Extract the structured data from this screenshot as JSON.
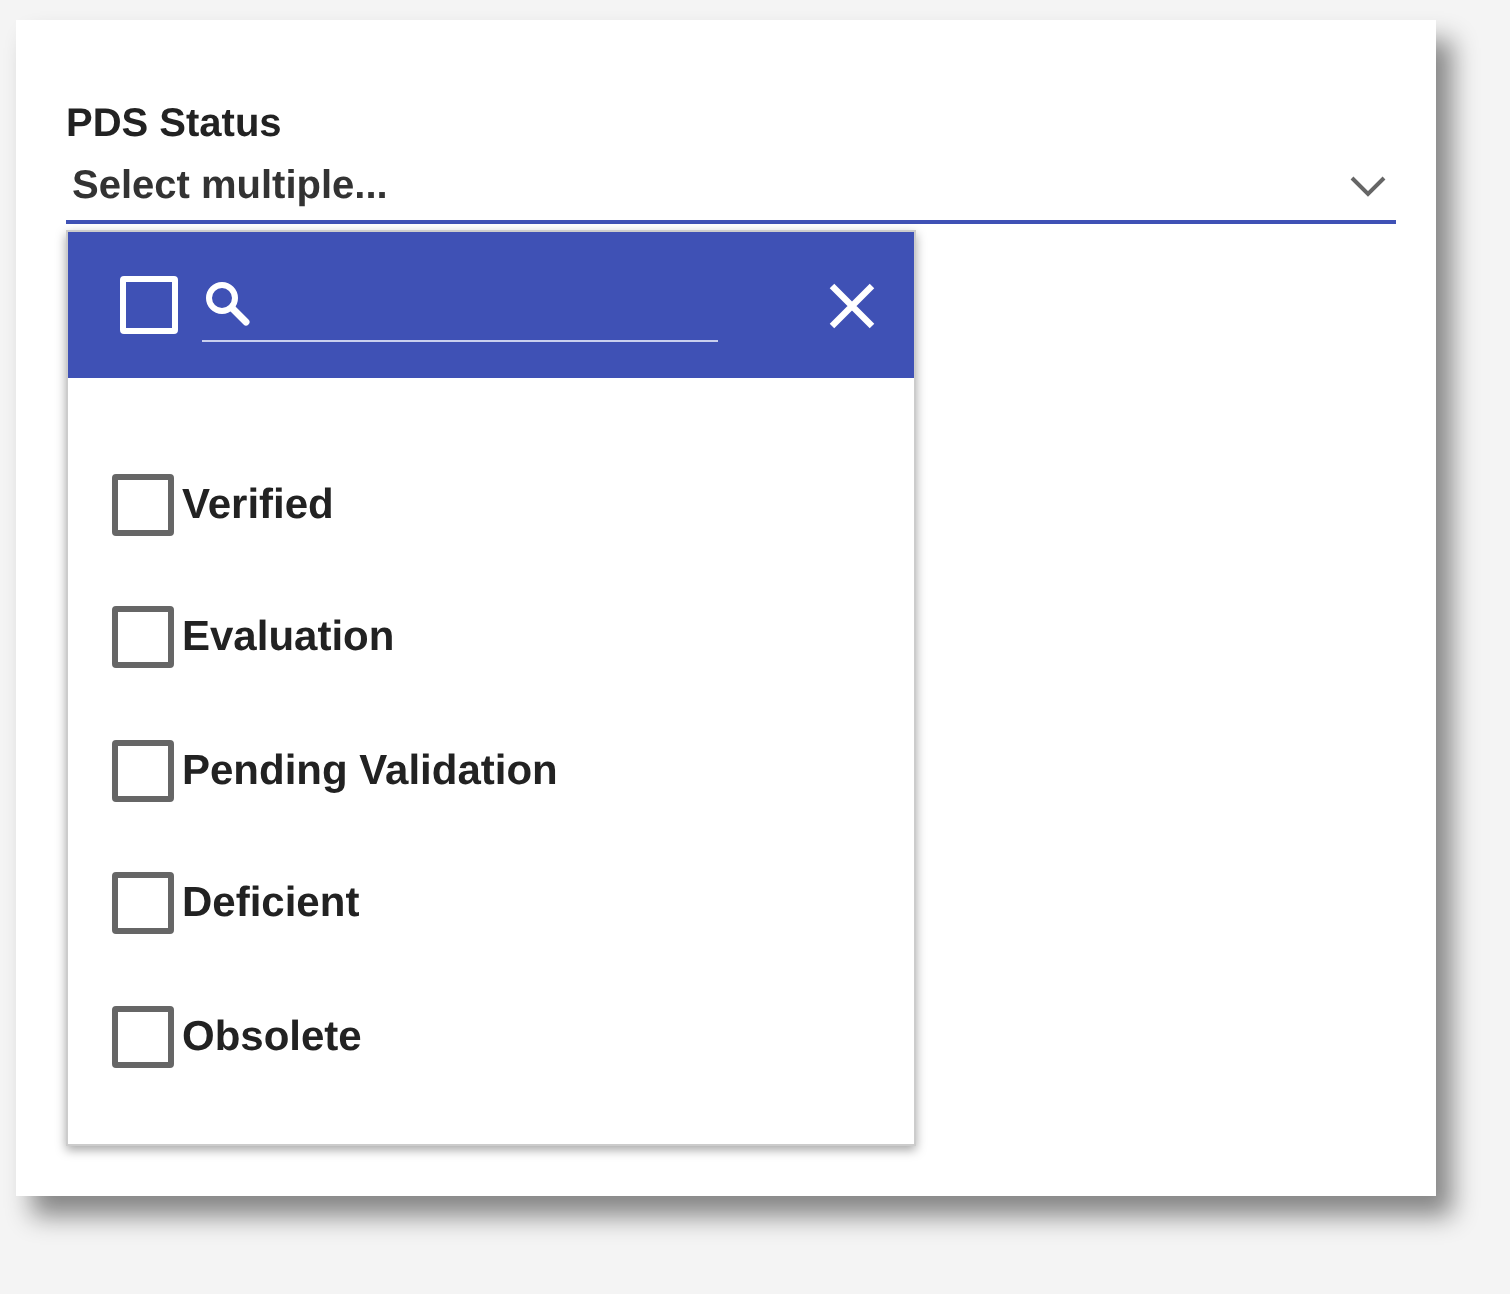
{
  "field": {
    "label": "PDS Status",
    "placeholder": "Select multiple..."
  },
  "dropdown": {
    "select_all": {
      "checked": false
    },
    "options": [
      {
        "label": "Verified",
        "checked": false
      },
      {
        "label": "Evaluation",
        "checked": false
      },
      {
        "label": "Pending Validation",
        "checked": false
      },
      {
        "label": "Deficient",
        "checked": false
      },
      {
        "label": "Obsolete",
        "checked": false
      }
    ]
  }
}
